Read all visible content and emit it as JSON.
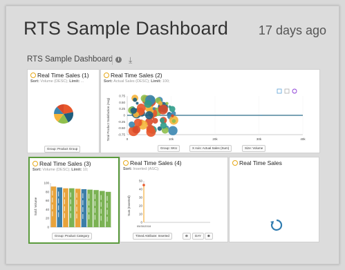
{
  "header": {
    "title": "RTS Sample Dashboard",
    "timestamp": "17 days ago"
  },
  "subheader": {
    "label": "RTS Sample Dashboard",
    "info_icon": "info-icon",
    "download_icon": "download-icon"
  },
  "panels": {
    "p1": {
      "title": "Real Time Sales (1)",
      "sort_key": "Sort:",
      "sort_val": "Volume (DESC);",
      "limit_key": "Limit:",
      "limit_val": "...",
      "group_label": "Group: Product Group"
    },
    "p2": {
      "title": "Real Time Sales (2)",
      "sort_key": "Sort:",
      "sort_val": "Actual Sales (DESC);",
      "limit_key": "Limit:",
      "limit_val": "100;",
      "ylabel": "Total Product Satisfaction (Avg)",
      "yticks": [
        "0.75",
        "0.50",
        "0.25",
        "0",
        "-0.25",
        "-0.50",
        "-0.75"
      ],
      "xticks": [
        "0",
        "10k",
        "20k",
        "30k",
        "40k"
      ],
      "pill_group": "Group: SKU",
      "pill_x": "X Axis: Actual Sales (Sum)",
      "pill_size": "Size: Volume"
    },
    "p3": {
      "title": "Real Time Sales (3)",
      "sort_key": "Sort:",
      "sort_val": "Volume (DESC);",
      "limit_key": "Limit:",
      "limit_val": "10;",
      "ylabel": "Sold: Volume",
      "yticks": [
        "100",
        "80",
        "60",
        "40",
        "20",
        "0"
      ],
      "group_label": "Group: Product Category"
    },
    "p4": {
      "title": "Real Time Sales (4)",
      "sort_key": "Sort:",
      "sort_val": "Inserted (ASC);",
      "ylabel": "Sum (Inserted)",
      "yticks": [
        "50",
        "40",
        "30",
        "20",
        "10",
        "0"
      ],
      "xtick": "05/30/2018",
      "pill_timed": "Timed Attribute: Inserted",
      "zoom_level": "DAY"
    },
    "p5": {
      "title": "Real Time Sales"
    }
  },
  "chart_data": [
    {
      "type": "pie",
      "values": [
        22,
        20,
        18,
        15,
        13,
        12
      ],
      "colors": [
        "#e8572b",
        "#1f5e7d",
        "#8fbf4d",
        "#f6b53b",
        "#3b86b0",
        "#d94a2a"
      ]
    },
    {
      "type": "scatter",
      "ylim": [
        -0.75,
        0.75
      ],
      "xlim": [
        0,
        40000
      ]
    },
    {
      "type": "bar",
      "ylim": [
        0,
        100
      ],
      "values": [
        92,
        90,
        88,
        88,
        87,
        86,
        85,
        84,
        82,
        80
      ],
      "colors": [
        "#e8a33b",
        "#3c7ea8",
        "#e8a33b",
        "#7bb254",
        "#e8a33b",
        "#3c7ea8",
        "#7bb254",
        "#7bb254",
        "#7bb254",
        "#7bb254"
      ]
    },
    {
      "type": "line",
      "ylim": [
        0,
        50
      ]
    }
  ]
}
